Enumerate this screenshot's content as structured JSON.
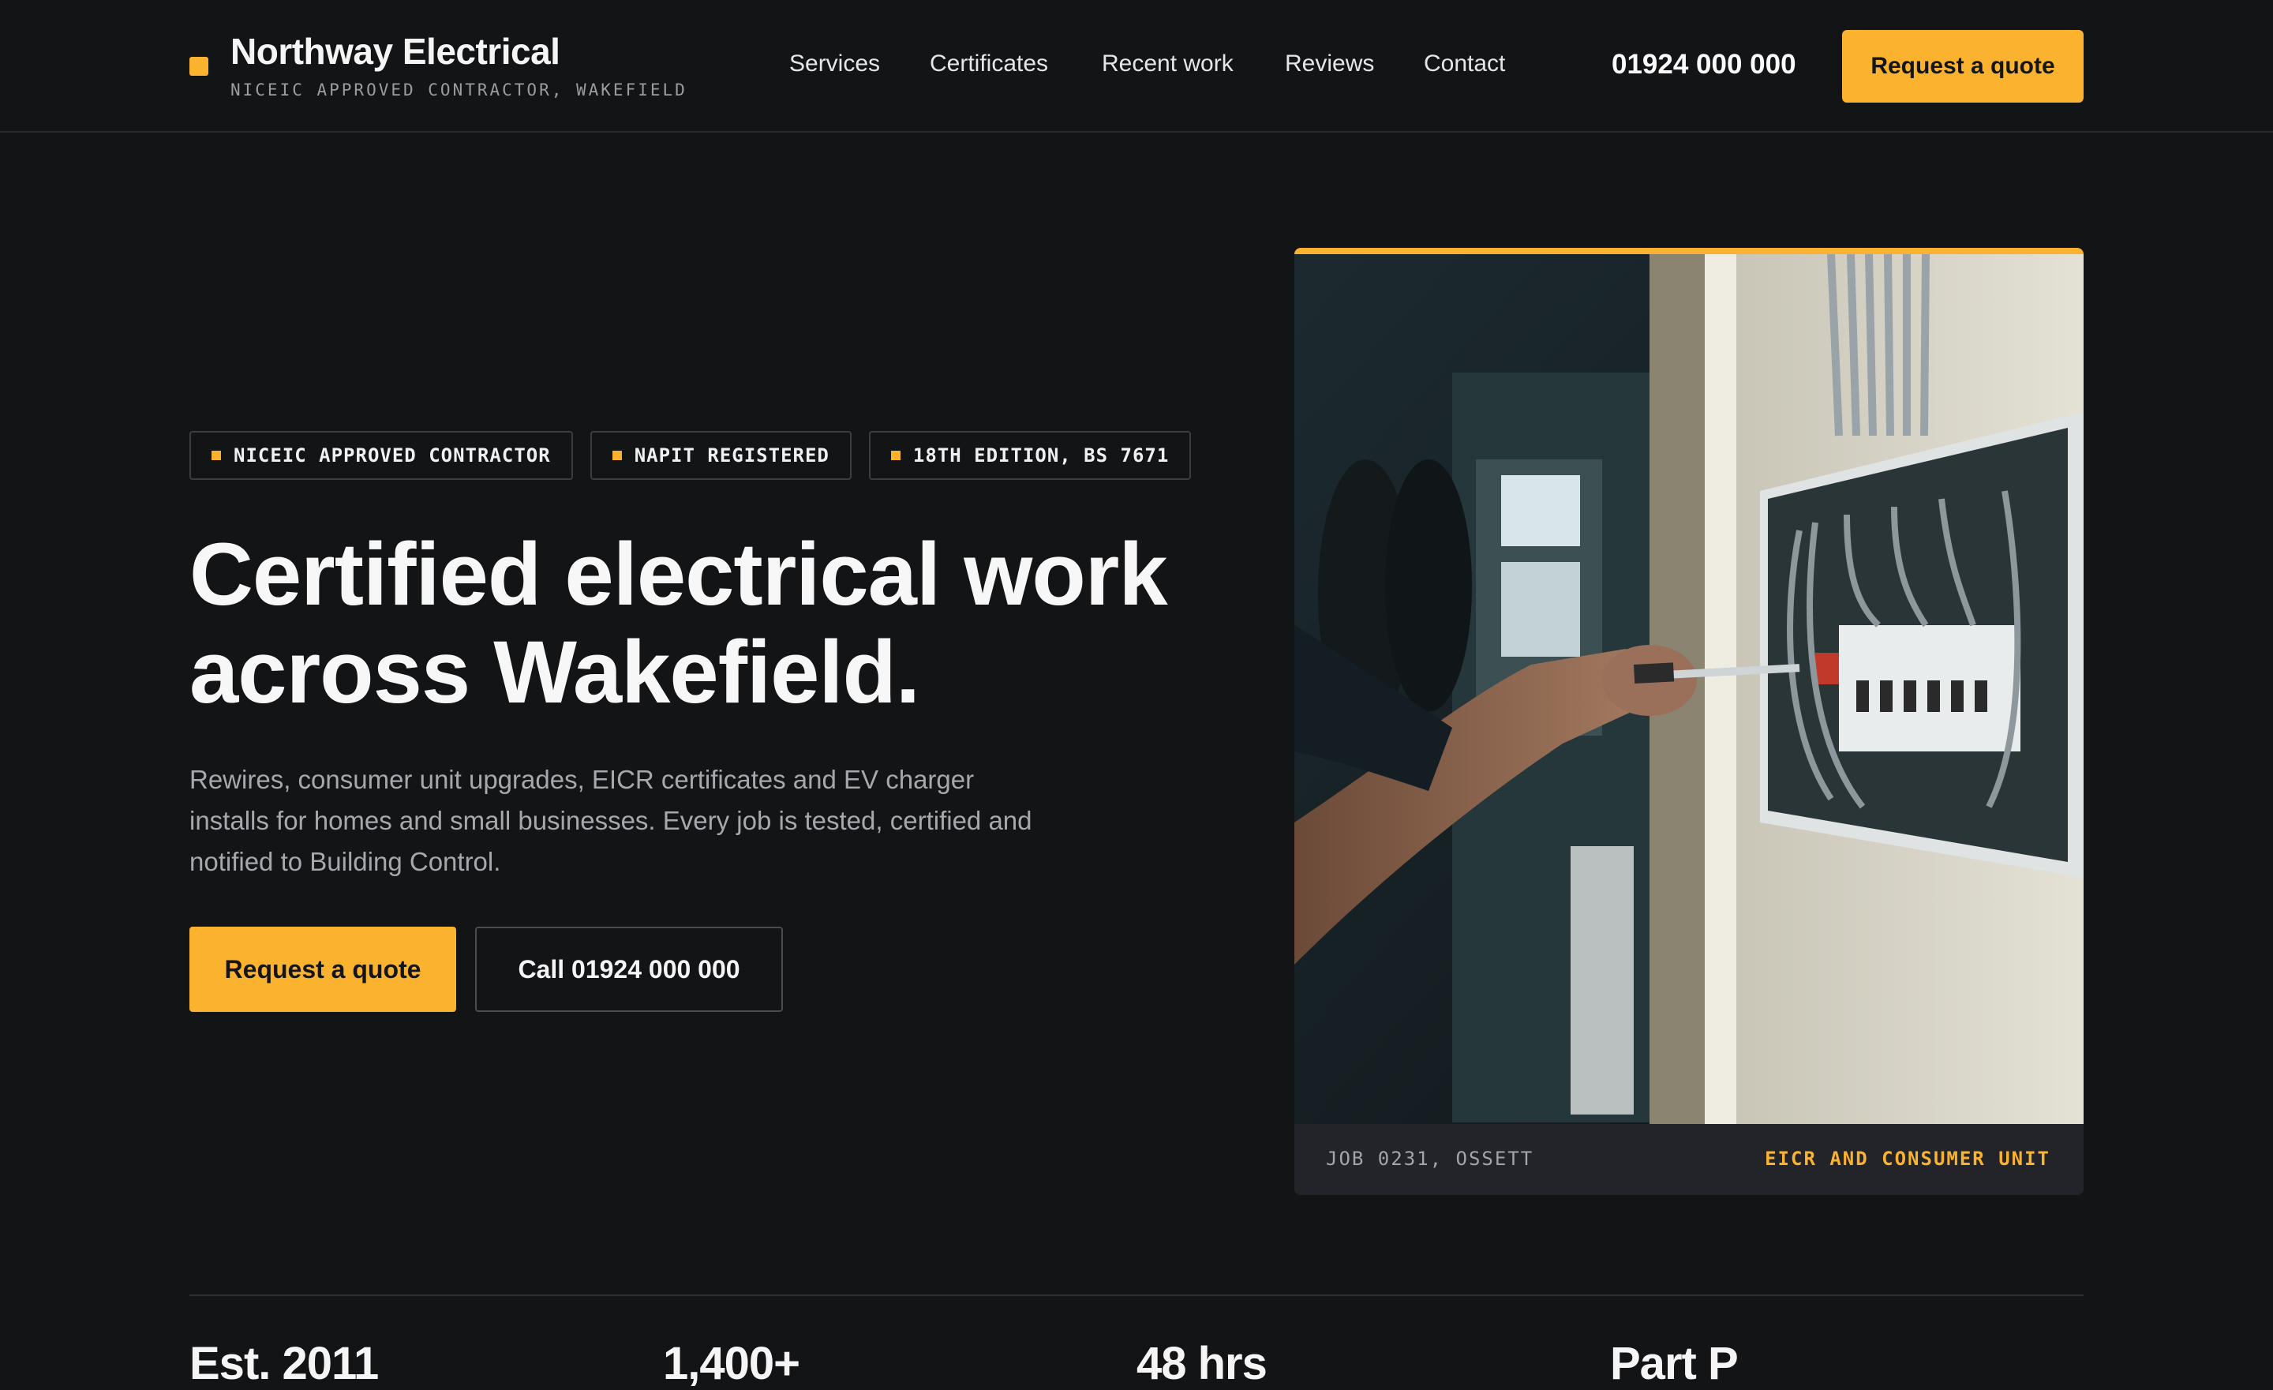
{
  "brand": {
    "name": "Northway Electrical",
    "tagline": "NICEIC APPROVED CONTRACTOR, WAKEFIELD",
    "accent_color": "#fbb22e"
  },
  "nav": {
    "items": [
      "Services",
      "Certificates",
      "Recent work",
      "Reviews",
      "Contact"
    ]
  },
  "header": {
    "phone": "01924 000 000",
    "cta_label": "Request a quote"
  },
  "hero": {
    "badges": [
      "NICEIC APPROVED CONTRACTOR",
      "NAPIT REGISTERED",
      "18TH EDITION, BS 7671"
    ],
    "title_line1": "Certified electrical work",
    "title_line2": "across Wakefield.",
    "subtitle": "Rewires, consumer unit upgrades, EICR certificates and EV charger installs for homes and small businesses. Every job is tested, certified and notified to Building Control.",
    "primary_cta": "Request a quote",
    "secondary_cta": "Call 01924 000 000"
  },
  "photo": {
    "caption_left": "JOB 0231, OSSETT",
    "caption_right": "EICR AND CONSUMER UNIT"
  },
  "stats": [
    "Est. 2011",
    "1,400+",
    "48 hrs",
    "Part P"
  ]
}
